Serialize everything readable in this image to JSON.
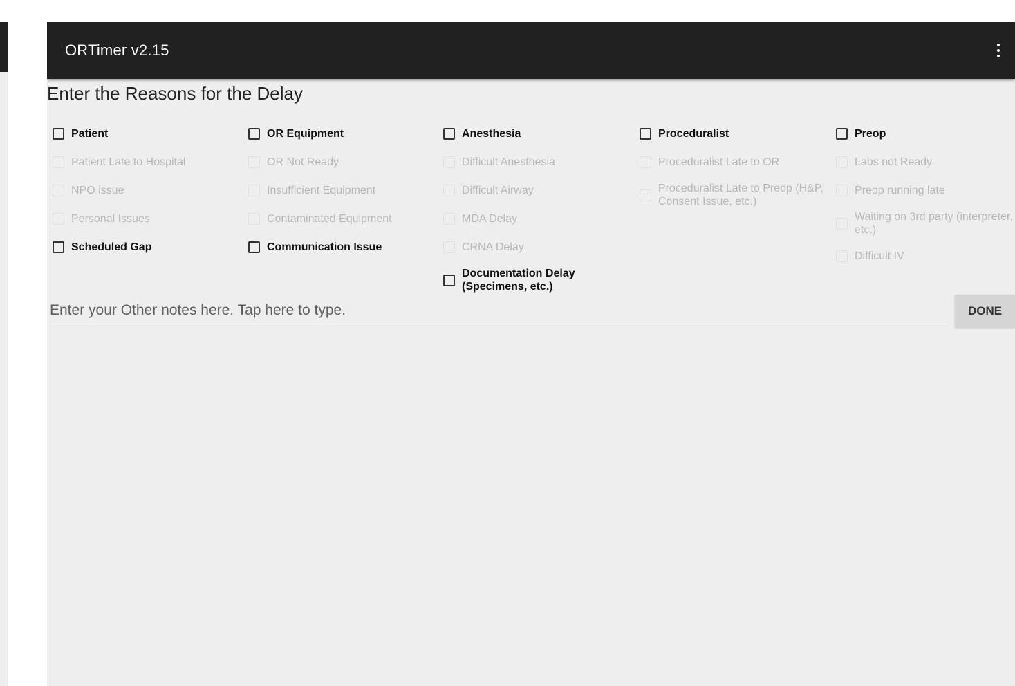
{
  "app": {
    "title": "ORTimer v2.15",
    "menu_icon": "overflow-menu-icon"
  },
  "heading": "Enter the Reasons for the Delay",
  "columns": [
    {
      "items": [
        {
          "label": "Patient",
          "kind": "category",
          "checked": false
        },
        {
          "label": "Patient Late to Hospital",
          "kind": "sub",
          "enabled": false,
          "checked": false
        },
        {
          "label": "NPO issue",
          "kind": "sub",
          "enabled": false,
          "checked": false
        },
        {
          "label": "Personal Issues",
          "kind": "sub",
          "enabled": false,
          "checked": false
        },
        {
          "label": "Scheduled Gap",
          "kind": "category",
          "checked": false
        }
      ]
    },
    {
      "items": [
        {
          "label": "OR Equipment",
          "kind": "category",
          "checked": false
        },
        {
          "label": "OR Not Ready",
          "kind": "sub",
          "enabled": false,
          "checked": false
        },
        {
          "label": "Insufficient Equipment",
          "kind": "sub",
          "enabled": false,
          "checked": false
        },
        {
          "label": "Contaminated Equipment",
          "kind": "sub",
          "enabled": false,
          "checked": false
        },
        {
          "label": "Communication Issue",
          "kind": "category",
          "checked": false
        }
      ]
    },
    {
      "items": [
        {
          "label": "Anesthesia",
          "kind": "category",
          "checked": false
        },
        {
          "label": "Difficult Anesthesia",
          "kind": "sub",
          "enabled": false,
          "checked": false
        },
        {
          "label": "Difficult Airway",
          "kind": "sub",
          "enabled": false,
          "checked": false
        },
        {
          "label": "MDA Delay",
          "kind": "sub",
          "enabled": false,
          "checked": false
        },
        {
          "label": "CRNA Delay",
          "kind": "sub",
          "enabled": false,
          "checked": false
        },
        {
          "label": "Documentation Delay (Specimens, etc.)",
          "kind": "category",
          "checked": false
        }
      ]
    },
    {
      "items": [
        {
          "label": "Proceduralist",
          "kind": "category",
          "checked": false
        },
        {
          "label": "Proceduralist Late to OR",
          "kind": "sub",
          "enabled": false,
          "checked": false
        },
        {
          "label": "Proceduralist Late to Preop (H&P, Consent Issue, etc.)",
          "kind": "sub",
          "enabled": false,
          "checked": false
        }
      ]
    },
    {
      "items": [
        {
          "label": "Preop",
          "kind": "category",
          "checked": false
        },
        {
          "label": "Labs not Ready",
          "kind": "sub",
          "enabled": false,
          "checked": false
        },
        {
          "label": "Preop running late",
          "kind": "sub",
          "enabled": false,
          "checked": false
        },
        {
          "label": "Waiting on 3rd party (interpreter, etc.)",
          "kind": "sub",
          "enabled": false,
          "checked": false
        },
        {
          "label": "Difficult IV",
          "kind": "sub",
          "enabled": false,
          "checked": false
        }
      ]
    }
  ],
  "notes": {
    "placeholder": "Enter your Other notes here. Tap here to type.",
    "value": ""
  },
  "done_label": "DONE"
}
